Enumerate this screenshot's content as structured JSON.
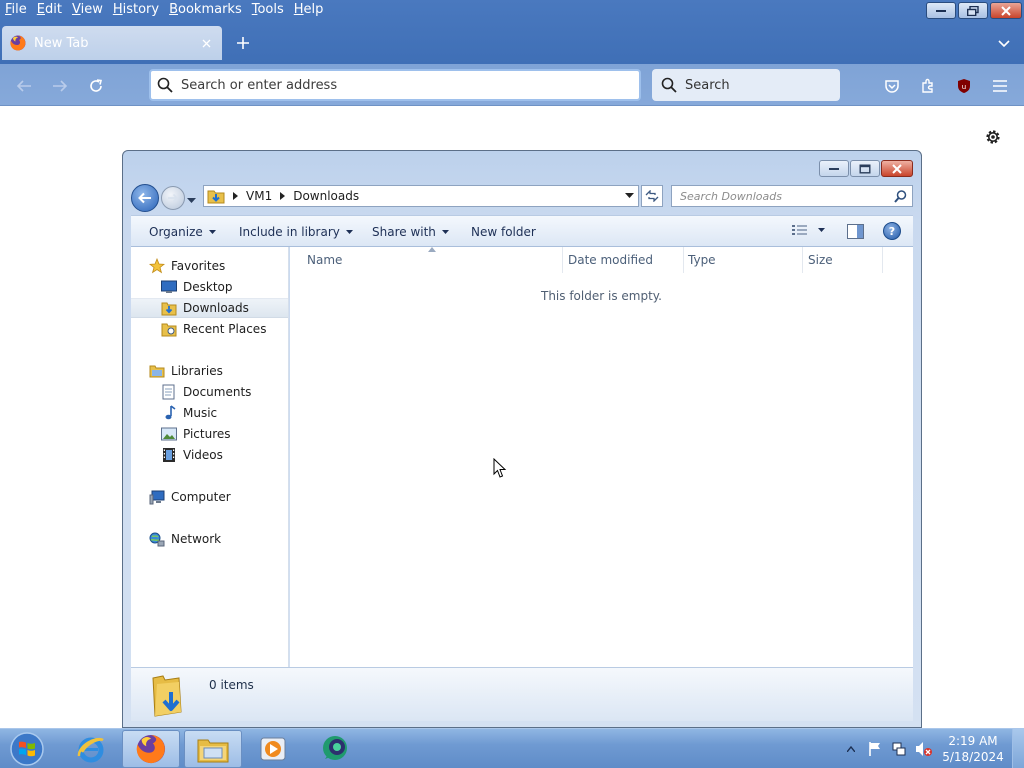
{
  "browser": {
    "menu": [
      {
        "label": "File",
        "key": "F",
        "rest": "ile"
      },
      {
        "label": "Edit",
        "key": "E",
        "rest": "dit"
      },
      {
        "label": "View",
        "key": "V",
        "rest": "iew"
      },
      {
        "label": "History",
        "key": "H",
        "rest": "istory"
      },
      {
        "label": "Bookmarks",
        "key": "B",
        "rest": "ookmarks"
      },
      {
        "label": "Tools",
        "key": "T",
        "rest": "ools"
      },
      {
        "label": "Help",
        "key": "H",
        "rest": "elp"
      }
    ],
    "tab_title": "New Tab",
    "url_placeholder": "Search or enter address",
    "search_label": "Search"
  },
  "explorer": {
    "breadcrumb": [
      "VM1",
      "Downloads"
    ],
    "search_placeholder": "Search Downloads",
    "commands": {
      "organize": "Organize",
      "include_in_library": "Include in library",
      "share_with": "Share with",
      "new_folder": "New folder"
    },
    "nav": {
      "favorites": "Favorites",
      "desktop": "Desktop",
      "downloads": "Downloads",
      "recent_places": "Recent Places",
      "libraries": "Libraries",
      "documents": "Documents",
      "music": "Music",
      "pictures": "Pictures",
      "videos": "Videos",
      "computer": "Computer",
      "network": "Network"
    },
    "columns": {
      "name": "Name",
      "date_modified": "Date modified",
      "type": "Type",
      "size": "Size"
    },
    "empty_message": "This folder is empty.",
    "items_count": "0 items"
  },
  "taskbar": {
    "time": "2:19 AM",
    "date": "5/18/2024"
  },
  "colors": {
    "accent": "#3f6fb6",
    "close_red": "#c9442b"
  }
}
